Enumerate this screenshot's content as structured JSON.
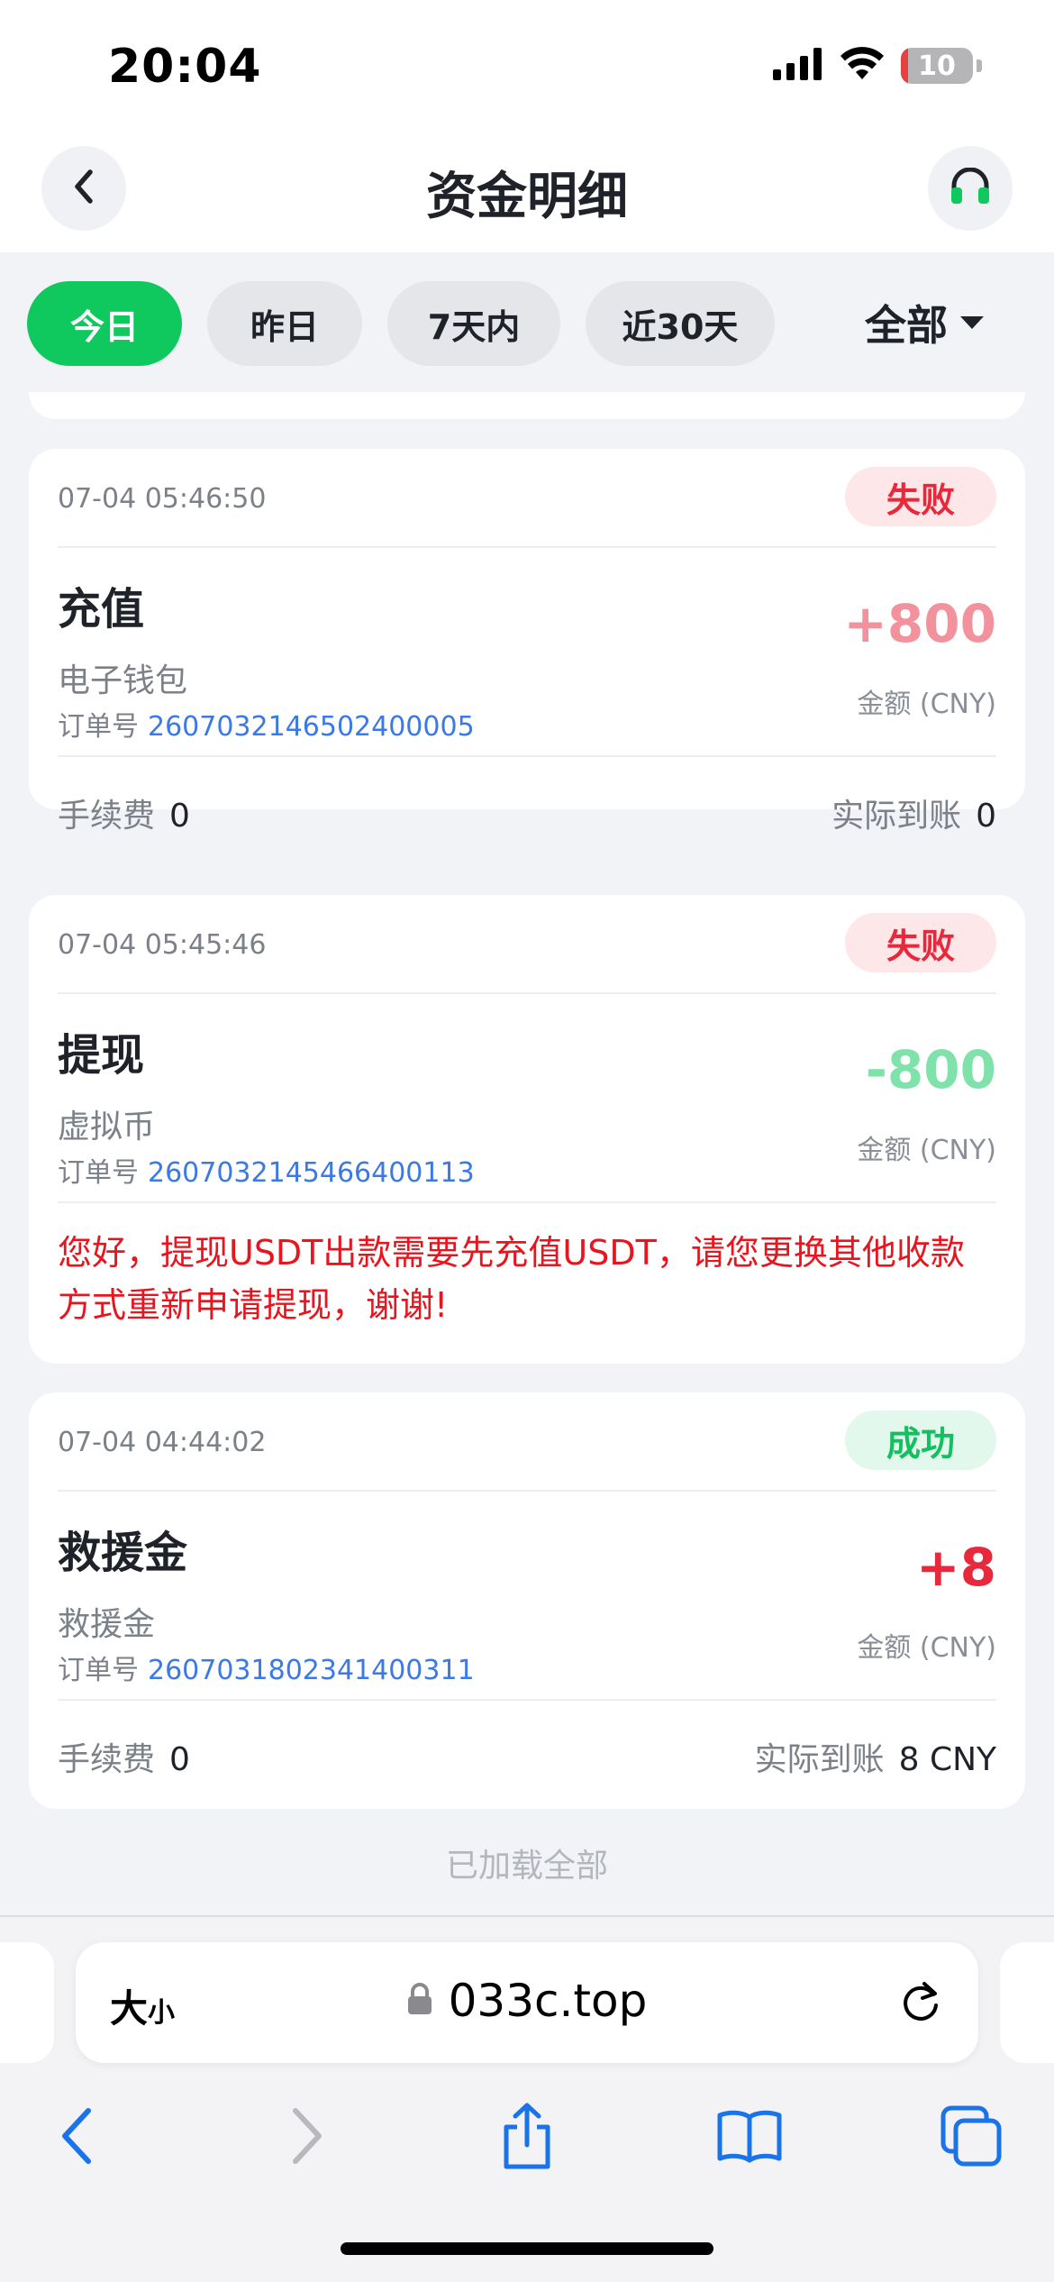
{
  "status_bar": {
    "time": "20:04",
    "battery": "10",
    "battery_level": 0.1,
    "signal_icon": "cellular-signal-icon",
    "wifi_icon": "wifi-icon"
  },
  "header": {
    "title": "资金明细",
    "back_icon": "chevron-left-icon",
    "service_icon": "headset-icon"
  },
  "filters": {
    "today": "今日",
    "yesterday": "昨日",
    "seven_days": "7天内",
    "thirty_days": "近30天",
    "type_select": "全部",
    "active": "today"
  },
  "records": [
    {
      "time": "07-04 05:46:50",
      "status": "失败",
      "type": "充值",
      "method": "电子钱包",
      "order_label": "订单号",
      "order_no": "2607032146502400005",
      "amount": "+800",
      "amount_label": "金额 (CNY)",
      "fee_label": "手续费",
      "fee": "0",
      "received_label": "实际到账",
      "received": "0"
    },
    {
      "time": "07-04 05:45:46",
      "status": "失败",
      "type": "提现",
      "method": "虚拟币",
      "order_label": "订单号",
      "order_no": "2607032145466400113",
      "amount": "-800",
      "amount_label": "金额 (CNY)",
      "remark": "您好，提现USDT出款需要先充值USDT，请您更换其他收款方式重新申请提现，谢谢!"
    },
    {
      "time": "07-04 04:44:02",
      "status": "成功",
      "type": "救援金",
      "method": "救援金",
      "order_label": "订单号",
      "order_no": "2607031802341400311",
      "amount": "+8",
      "amount_label": "金额 (CNY)",
      "fee_label": "手续费",
      "fee": "0",
      "received_label": "实际到账",
      "received": "8 CNY"
    }
  ],
  "list_footer": "已加载全部",
  "browser": {
    "text_size_big": "大",
    "text_size_small": "小",
    "url": "033c.top",
    "lock_icon": "lock-icon",
    "reload_icon": "reload-icon",
    "toolbar_icons": [
      "back-arrow-icon",
      "forward-arrow-icon",
      "share-icon",
      "bookmarks-icon",
      "tabs-icon"
    ]
  },
  "colors": {
    "accent_green": "#0fc85e",
    "fail_red": "#e8283b",
    "link_blue": "#3a79e6"
  }
}
